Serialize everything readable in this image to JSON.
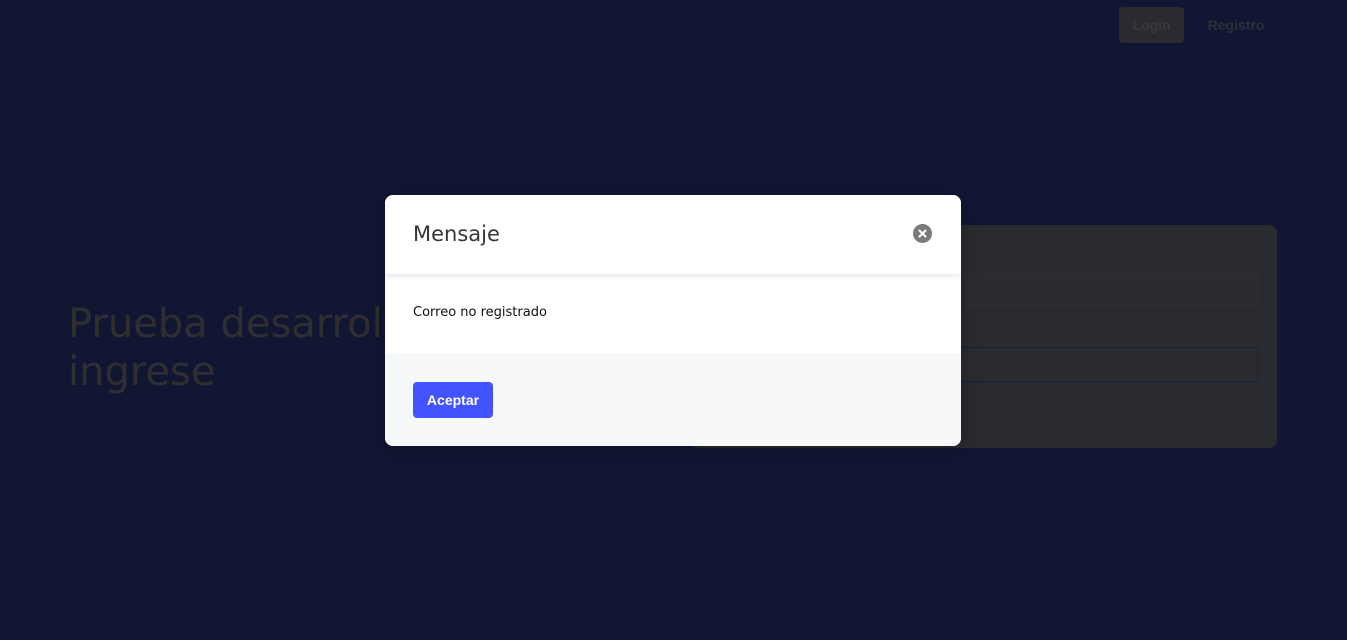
{
  "nav": {
    "login_label": "Login",
    "register_label": "Registro"
  },
  "hero": {
    "title_line1": "Prueba desarrolla",
    "title_line2": "ingrese"
  },
  "modal": {
    "title": "Mensaje",
    "message": "Correo no registrado",
    "accept_label": "Aceptar",
    "close_icon": "close-circle-icon"
  },
  "colors": {
    "background": "#111633",
    "accent": "#4353ff",
    "modal_footer": "#f6f8fa"
  }
}
